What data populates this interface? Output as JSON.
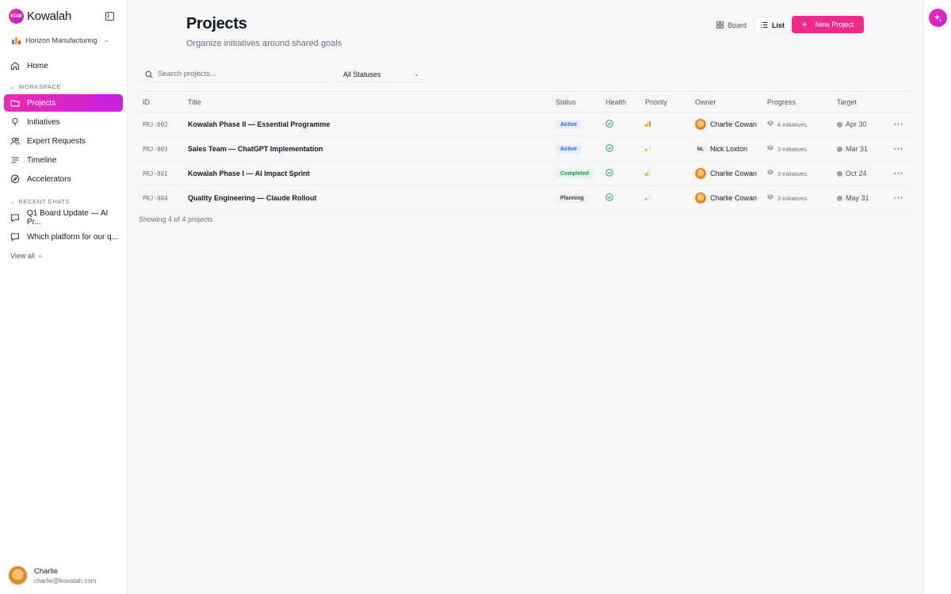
{
  "brand": {
    "logo_text": "KOW",
    "name": "Kowalah"
  },
  "org": {
    "name": "Horizon Manufacturing"
  },
  "nav": {
    "home": "Home",
    "workspace_label": "WORKSPACE",
    "items": [
      {
        "label": "Projects",
        "icon": "folder-icon"
      },
      {
        "label": "Initiatives",
        "icon": "lightbulb-icon"
      },
      {
        "label": "Expert Requests",
        "icon": "users-icon"
      },
      {
        "label": "Timeline",
        "icon": "timeline-icon"
      },
      {
        "label": "Accelerators",
        "icon": "compass-icon"
      }
    ],
    "recent_label": "RECENT CHATS",
    "chats": [
      {
        "label": "Q1 Board Update — AI Pr..."
      },
      {
        "label": "Which platform for our q..."
      }
    ],
    "view_all": "View all"
  },
  "user": {
    "name": "Charlie",
    "email": "charlie@kowalah.com"
  },
  "header": {
    "title": "Projects",
    "subtitle": "Organize initiatives around shared goals",
    "board_label": "Board",
    "list_label": "List",
    "new_button": "New Project"
  },
  "filters": {
    "search_placeholder": "Search projects...",
    "status": "All Statuses"
  },
  "table": {
    "columns": [
      "ID",
      "Title",
      "Status",
      "Health",
      "Priority",
      "Owner",
      "Progress",
      "Target"
    ],
    "rows": [
      {
        "id": "PRJ-002",
        "title": "Kowalah Phase II — Essential Programme",
        "status": "Active",
        "priority_level": 3,
        "owner": "Charlie Cowan",
        "owner_initials": "",
        "progress": "4 initiatives",
        "target": "Apr 30"
      },
      {
        "id": "PRJ-003",
        "title": "Sales Team — ChatGPT Implementation",
        "status": "Active",
        "priority_level": 1,
        "owner": "Nick Loxton",
        "owner_initials": "NL",
        "progress": "3 initiatives",
        "target": "Mar 31"
      },
      {
        "id": "PRJ-001",
        "title": "Kowalah Phase I — AI Impact Sprint",
        "status": "Completed",
        "priority_level": 2,
        "owner": "Charlie Cowan",
        "owner_initials": "",
        "progress": "3 initiatives",
        "target": "Oct 24"
      },
      {
        "id": "PRJ-004",
        "title": "Quality Engineering — Claude Rollout",
        "status": "Planning",
        "priority_level": 1,
        "owner": "Charlie Cowan",
        "owner_initials": "",
        "progress": "3 initiatives",
        "target": "May 31"
      }
    ],
    "menu_glyph": "···"
  },
  "footer": {
    "showing": "Showing 4 of 4 projects"
  },
  "colors": {
    "accent": "#ee2a8a",
    "active": "#2a5fd6",
    "completed": "#1e9150",
    "health_ok": "#22a35a",
    "priority": "#f59e0b"
  }
}
